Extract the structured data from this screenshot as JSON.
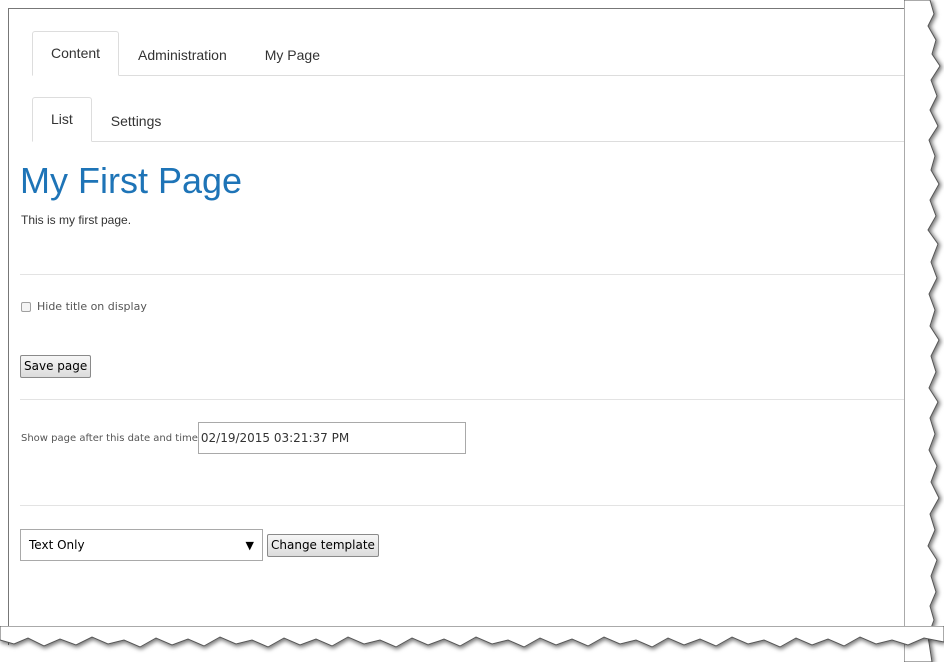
{
  "primary_tabs": [
    {
      "label": "Content",
      "active": true
    },
    {
      "label": "Administration",
      "active": false
    },
    {
      "label": "My Page",
      "active": false
    }
  ],
  "secondary_tabs": [
    {
      "label": "List",
      "active": true
    },
    {
      "label": "Settings",
      "active": false
    }
  ],
  "page": {
    "title": "My First Page",
    "body": "This is my first page."
  },
  "form": {
    "hide_title_label": "Hide title on display",
    "hide_title_checked": false,
    "save_label": "Save page",
    "schedule_label": "Show page after this date and time",
    "schedule_value": "02/19/2015 03:21:37 PM",
    "template_selected": "Text Only",
    "change_template_label": "Change template"
  },
  "colors": {
    "title": "#1e74b7",
    "tab_border": "#dddddd"
  }
}
